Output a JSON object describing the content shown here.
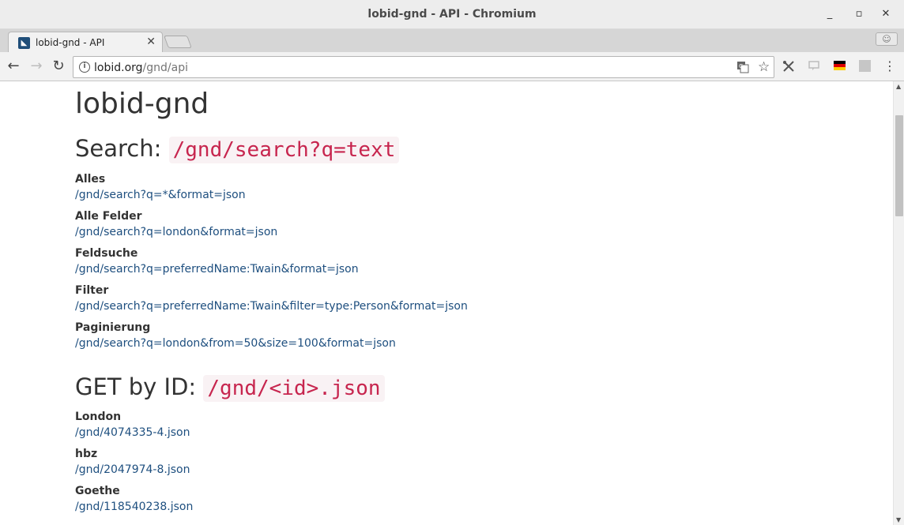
{
  "window": {
    "title": "lobid-gnd - API - Chromium",
    "minimize": "_",
    "maximize": "▫",
    "close": "✕"
  },
  "tab": {
    "title": "lobid-gnd - API",
    "close": "✕"
  },
  "toolbar": {
    "url_host": "lobid.org",
    "url_path": "/gnd/api",
    "flag_colors": [
      "#000000",
      "#dd0000",
      "#ffce00"
    ]
  },
  "icons": {
    "back": "←",
    "forward": "→",
    "reload": "↻",
    "info": "i",
    "translate": "translate-icon",
    "bookmark": "☆",
    "extension": "extension-icon",
    "cast": "cast-icon",
    "menu": "⋮"
  },
  "page": {
    "heading": "lobid-gnd",
    "search": {
      "title": "Search: ",
      "code": "/gnd/search?q=text",
      "examples": [
        {
          "label": "Alles",
          "link": "/gnd/search?q=*&format=json"
        },
        {
          "label": "Alle Felder",
          "link": "/gnd/search?q=london&format=json"
        },
        {
          "label": "Feldsuche",
          "link": "/gnd/search?q=preferredName:Twain&format=json"
        },
        {
          "label": "Filter",
          "link": "/gnd/search?q=preferredName:Twain&filter=type:Person&format=json"
        },
        {
          "label": "Paginierung",
          "link": "/gnd/search?q=london&from=50&size=100&format=json"
        }
      ]
    },
    "get": {
      "title": "GET by ID: ",
      "code": "/gnd/<id>.json",
      "examples": [
        {
          "label": "London",
          "link": "/gnd/4074335-4.json"
        },
        {
          "label": "hbz",
          "link": "/gnd/2047974-8.json"
        },
        {
          "label": "Goethe",
          "link": "/gnd/118540238.json"
        }
      ]
    }
  }
}
